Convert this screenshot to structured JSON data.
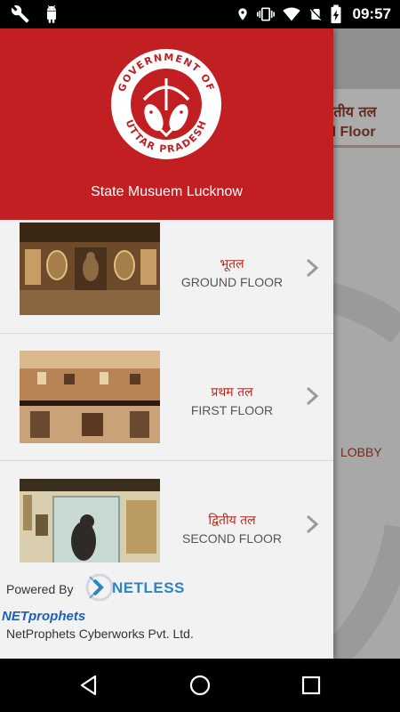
{
  "status_bar": {
    "time": "09:57",
    "left_icons": [
      "wrench-icon",
      "android-debug-icon"
    ],
    "right_icons": [
      "location-icon",
      "vibrate-icon",
      "wifi-icon",
      "no-sim-icon",
      "battery-charging-icon"
    ]
  },
  "background": {
    "tab_hindi": "द्वितीय तल",
    "tab_english": "rd Floor",
    "lobby_label": "LOBBY"
  },
  "drawer": {
    "header": {
      "emblem_text_top": "GOVERNMENT OF",
      "emblem_text_bottom": "UTTAR PRADESH",
      "title": "State Musuem Lucknow"
    },
    "items": [
      {
        "hindi": "भूतल",
        "english": "GROUND FLOOR"
      },
      {
        "hindi": "प्रथम तल",
        "english": "FIRST FLOOR"
      },
      {
        "hindi": "द्वितीय तल",
        "english": "SECOND FLOOR"
      }
    ],
    "footer": {
      "powered_by": "Powered By",
      "netless": "NETLESS",
      "netprophets": "NETprophets",
      "company": "NetProphets Cyberworks Pvt. Ltd."
    }
  },
  "nav_bar": {
    "buttons": [
      "back-icon",
      "home-icon",
      "recents-icon"
    ]
  },
  "colors": {
    "header_red": "#c21f22",
    "hindi_label": "#b8281e",
    "netless_blue": "#2d83c4"
  }
}
